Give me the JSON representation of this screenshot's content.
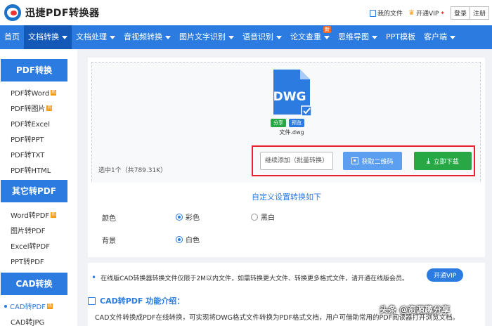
{
  "header": {
    "brand": "迅捷PDF转换器",
    "my_files": "我的文件",
    "open_vip": "开通VIP",
    "hot_mark": "✦",
    "login": "登录",
    "register": "注册"
  },
  "nav": {
    "items": [
      {
        "label": "首页",
        "caret": false,
        "active": false
      },
      {
        "label": "文档转换",
        "caret": true,
        "active": true
      },
      {
        "label": "文档处理",
        "caret": true,
        "active": false
      },
      {
        "label": "音视频转换",
        "caret": true,
        "active": false
      },
      {
        "label": "图片文字识别",
        "caret": true,
        "active": false
      },
      {
        "label": "语音识别",
        "caret": true,
        "active": false
      },
      {
        "label": "论文查重",
        "caret": true,
        "active": false,
        "badge": "新"
      },
      {
        "label": "思维导图",
        "caret": true,
        "active": false
      },
      {
        "label": "PPT模板",
        "caret": false,
        "active": false
      },
      {
        "label": "客户端",
        "caret": true,
        "active": false
      }
    ]
  },
  "sidebar": {
    "sections": [
      {
        "title": "PDF转换",
        "items": [
          "PDF转Word",
          "PDF转图片",
          "PDF转Excel",
          "PDF转PPT",
          "PDF转TXT",
          "PDF转HTML"
        ]
      },
      {
        "title": "其它转PDF",
        "items": [
          "Word转PDF",
          "图片转PDF",
          "Excel转PDF",
          "PPT转PDF"
        ]
      },
      {
        "title": "CAD转换",
        "items": [
          "CAD转PDF",
          "CAD转JPG"
        ]
      }
    ],
    "hot_tag": "热"
  },
  "upload": {
    "file_ext": "DWG",
    "share": "分享",
    "preview": "预览",
    "file_name": "文件.dwg",
    "selected_info": "选中1个（共789.31K）",
    "add_more": "继续添加（批量转换）",
    "qr_button": "获取二维码",
    "download_button": "立即下载"
  },
  "settings": {
    "title": "自定义设置转换如下",
    "color_label": "颜色",
    "color_options": [
      "彩色",
      "黑白"
    ],
    "color_selected": "彩色",
    "bg_label": "背景",
    "bg_options": [
      "白色"
    ],
    "bg_selected": "白色"
  },
  "notice": {
    "text": "在线版CAD转换器转换文件仅限于2M以内文件，如需转换更大文件、转换更多格式文件，请开通在线版会员。",
    "vip_button": "开通VIP",
    "feature_title": "CAD转PDF 功能介绍：",
    "feature_desc": "CAD文件转换成PDF在线转换，可实现将DWG格式文件转换为PDF格式文档，用户可借助常用的PDF阅读器打开浏览文档。"
  },
  "watermark": "头条 @资源趣分享",
  "colors": {
    "primary": "#2b7be0",
    "nav_active": "#1559b8",
    "success": "#27a844",
    "highlight": "#e8222c"
  }
}
